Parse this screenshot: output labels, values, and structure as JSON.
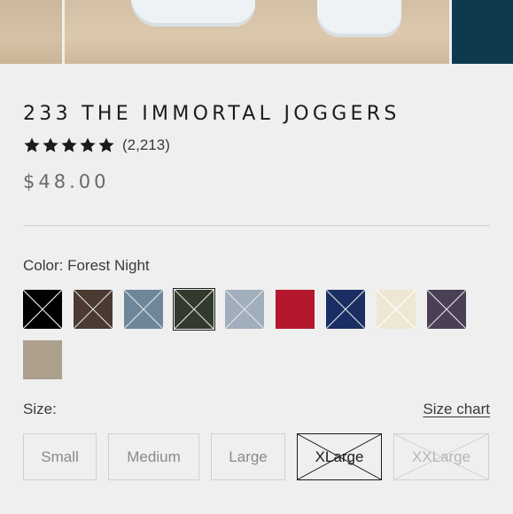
{
  "product": {
    "title": "233 THE IMMORTAL JOGGERS",
    "rating_count": "(2,213)",
    "stars": 5,
    "price": "$48.00"
  },
  "color": {
    "label": "Color: Forest Night",
    "swatches": [
      {
        "name": "black",
        "hex": "#000000",
        "crossed": true
      },
      {
        "name": "brown",
        "hex": "#4a3a32",
        "crossed": true
      },
      {
        "name": "slate-blue",
        "hex": "#6d8799",
        "crossed": true
      },
      {
        "name": "forest-night",
        "hex": "#313a2d",
        "crossed": true,
        "selected": true
      },
      {
        "name": "light-blue-gray",
        "hex": "#a1aebb",
        "crossed": true
      },
      {
        "name": "red",
        "hex": "#b4182e",
        "crossed": false
      },
      {
        "name": "navy",
        "hex": "#1a2e63",
        "crossed": true
      },
      {
        "name": "cream",
        "hex": "#ede7d4",
        "crossed": true
      },
      {
        "name": "plum",
        "hex": "#4b3f56",
        "crossed": true
      },
      {
        "name": "taupe",
        "hex": "#aca08c",
        "crossed": false
      }
    ]
  },
  "size": {
    "label": "Size:",
    "chart_link": "Size chart",
    "options": [
      {
        "label": "Small",
        "state": "available"
      },
      {
        "label": "Medium",
        "state": "available"
      },
      {
        "label": "Large",
        "state": "available"
      },
      {
        "label": "XLarge",
        "state": "sold-out"
      },
      {
        "label": "XXLarge",
        "state": "sold-out"
      }
    ]
  }
}
